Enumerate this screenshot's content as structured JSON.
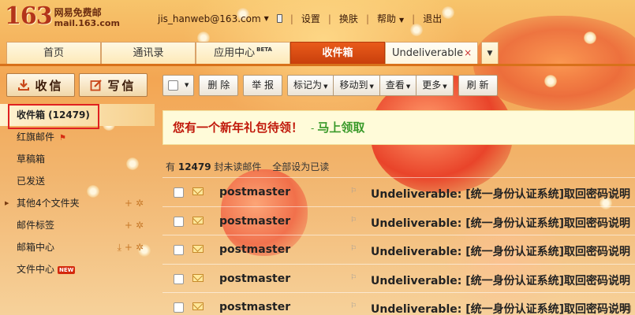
{
  "header": {
    "logo_number": "163",
    "logo_cn": "网易免费邮",
    "logo_en": "mail.163.com",
    "user_email": "jis_hanweb@163.com",
    "links": [
      "设置",
      "换肤",
      "帮助",
      "退出"
    ]
  },
  "tabs": [
    {
      "label": "首页"
    },
    {
      "label": "通讯录"
    },
    {
      "label": "应用中心",
      "badge": "BETA"
    },
    {
      "label": "收件箱",
      "active": true
    },
    {
      "label": "Undeliverable",
      "closable": true
    }
  ],
  "sidebar": {
    "receive_label": "收信",
    "write_label": "写信",
    "items": [
      {
        "label": "收件箱 (12479)"
      },
      {
        "label": "红旗邮件"
      },
      {
        "label": "草稿箱"
      },
      {
        "label": "已发送"
      },
      {
        "label": "其他4个文件夹"
      },
      {
        "label": "邮件标签"
      },
      {
        "label": "邮箱中心"
      },
      {
        "label": "文件中心",
        "badge": "NEW"
      }
    ]
  },
  "toolbar": {
    "delete": "删 除",
    "report": "举 报",
    "mark_as": "标记为",
    "move_to": "移动到",
    "view": "查看",
    "more": "更多",
    "refresh": "刷 新"
  },
  "promo": {
    "text": "您有一个新年礼包待领！",
    "dash": "-",
    "link": "马上领取"
  },
  "unread": {
    "prefix": "有",
    "count": "12479",
    "suffix": "封未读邮件",
    "mark_all": "全部设为已读"
  },
  "mails": [
    {
      "from": "postmaster",
      "subject": "Undeliverable: [统一身份认证系统]取回密码说明:"
    },
    {
      "from": "postmaster",
      "subject": "Undeliverable: [统一身份认证系统]取回密码说明:"
    },
    {
      "from": "postmaster",
      "subject": "Undeliverable: [统一身份认证系统]取回密码说明:"
    },
    {
      "from": "postmaster",
      "subject": "Undeliverable: [统一身份认证系统]取回密码说明:"
    },
    {
      "from": "postmaster",
      "subject": "Undeliverable: [统一身份认证系统]取回密码说明:"
    }
  ],
  "watermark": "bg"
}
